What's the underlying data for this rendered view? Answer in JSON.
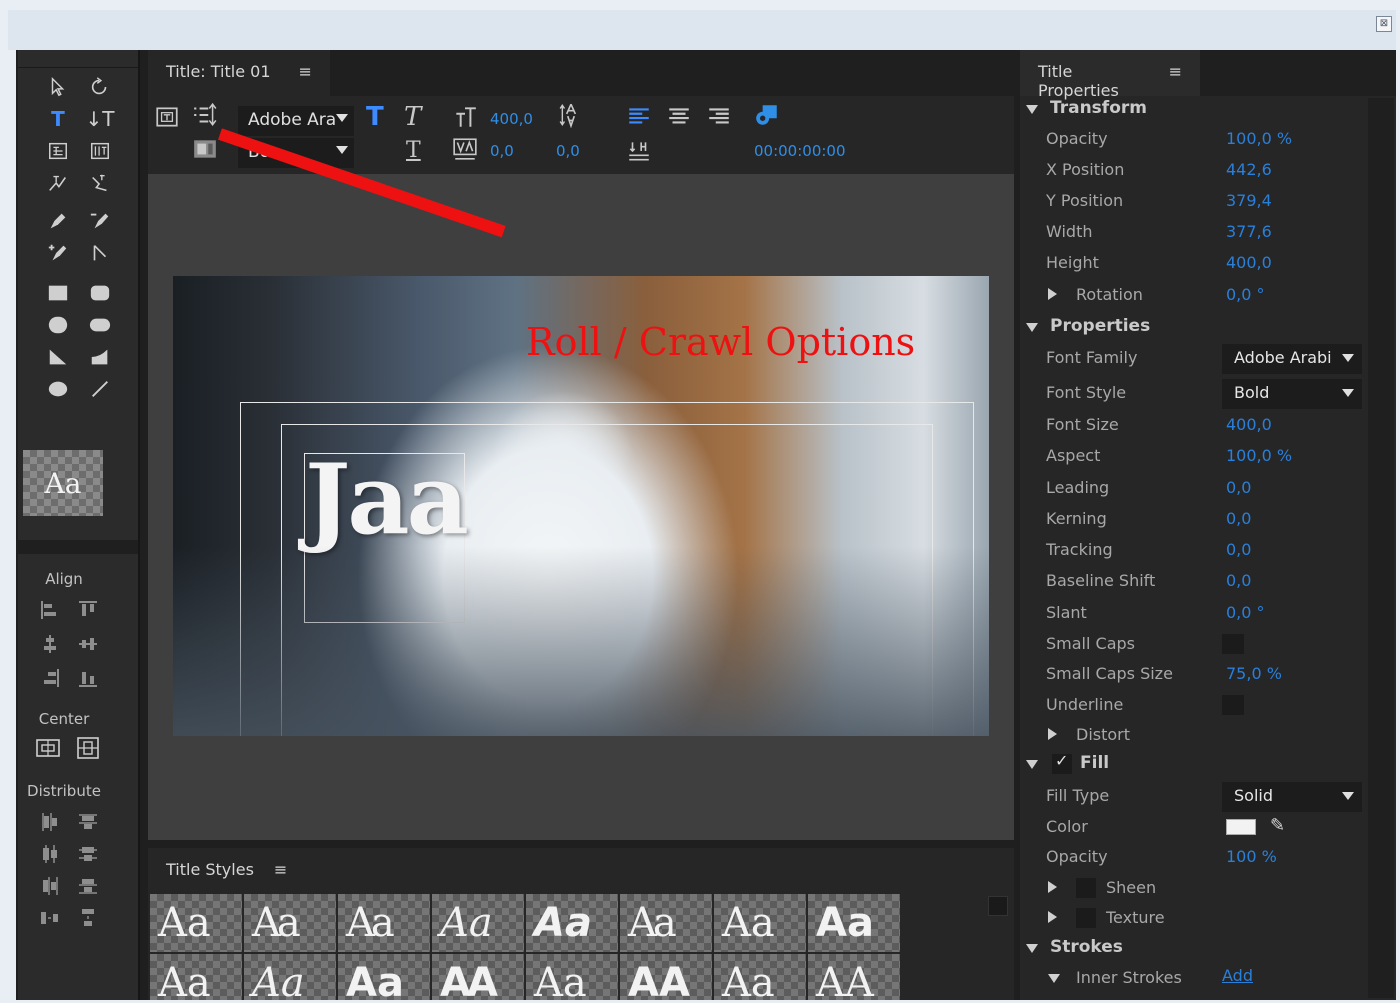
{
  "window": {
    "close_glyph": "⊠"
  },
  "tools": {
    "sample_label": "Aa",
    "sections": {
      "align": "Align",
      "center": "Center",
      "distribute": "Distribute"
    }
  },
  "title_panel": {
    "tab_label": "Title: Title 01",
    "menu_glyph": "≡",
    "font_family_value": "Adobe Ara",
    "font_style_value": "Bo",
    "font_size_value": "400,0",
    "kerning_value": "0,0",
    "leading_value": "0,0",
    "timecode": "00:00:00:00",
    "canvas_text": "Jaa",
    "annotation": "Roll / Crawl Options",
    "annotation_color": "#ee1111"
  },
  "title_styles": {
    "tab_label": "Title Styles",
    "menu_glyph": "≡",
    "swatches_row1": [
      "Aa",
      "Aa",
      "Aa",
      "Aa",
      "Aa",
      "Aa",
      "Aa",
      "Aa"
    ],
    "swatches_row2": [
      "Aa",
      "Aa",
      "Aa",
      "AA",
      "Aa",
      "AA",
      "Aa",
      "AA"
    ]
  },
  "properties": {
    "tab_label": "Title Properties",
    "menu_glyph": "≡",
    "accent_color": "#2a7fd9",
    "transform": {
      "label": "Transform",
      "opacity": {
        "label": "Opacity",
        "value": "100,0 %"
      },
      "x_position": {
        "label": "X Position",
        "value": "442,6"
      },
      "y_position": {
        "label": "Y Position",
        "value": "379,4"
      },
      "width": {
        "label": "Width",
        "value": "377,6"
      },
      "height": {
        "label": "Height",
        "value": "400,0"
      },
      "rotation": {
        "label": "Rotation",
        "value": "0,0 °"
      }
    },
    "properties": {
      "label": "Properties",
      "font_family": {
        "label": "Font Family",
        "value": "Adobe Arabi"
      },
      "font_style": {
        "label": "Font Style",
        "value": "Bold"
      },
      "font_size": {
        "label": "Font Size",
        "value": "400,0"
      },
      "aspect": {
        "label": "Aspect",
        "value": "100,0 %"
      },
      "leading": {
        "label": "Leading",
        "value": "0,0"
      },
      "kerning": {
        "label": "Kerning",
        "value": "0,0"
      },
      "tracking": {
        "label": "Tracking",
        "value": "0,0"
      },
      "baseline_shift": {
        "label": "Baseline Shift",
        "value": "0,0"
      },
      "slant": {
        "label": "Slant",
        "value": "0,0 °"
      },
      "small_caps": {
        "label": "Small Caps"
      },
      "small_caps_size": {
        "label": "Small Caps Size",
        "value": "75,0 %"
      },
      "underline": {
        "label": "Underline"
      },
      "distort": {
        "label": "Distort"
      }
    },
    "fill": {
      "label": "Fill",
      "check_glyph": "✓",
      "fill_type": {
        "label": "Fill Type",
        "value": "Solid"
      },
      "color": {
        "label": "Color",
        "swatch": "#f2f2f2"
      },
      "opacity": {
        "label": "Opacity",
        "value": "100 %"
      },
      "sheen": {
        "label": "Sheen"
      },
      "texture": {
        "label": "Texture"
      }
    },
    "strokes": {
      "label": "Strokes",
      "inner_strokes": {
        "label": "Inner Strokes",
        "action": "Add"
      }
    }
  }
}
